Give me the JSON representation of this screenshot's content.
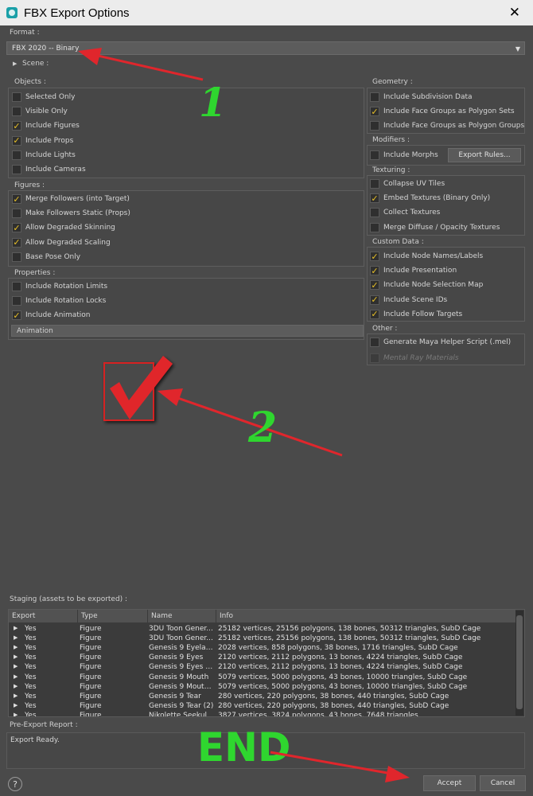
{
  "window": {
    "title": "FBX Export Options",
    "close_glyph": "✕"
  },
  "format": {
    "label": "Format :",
    "value": "FBX 2020 -- Binary"
  },
  "scene": {
    "label": "Scene :"
  },
  "objects": {
    "label": "Objects :",
    "items": [
      {
        "label": "Selected Only",
        "checked": false
      },
      {
        "label": "Visible Only",
        "checked": false
      },
      {
        "label": "Include Figures",
        "checked": true
      },
      {
        "label": "Include Props",
        "checked": true
      },
      {
        "label": "Include Lights",
        "checked": false
      },
      {
        "label": "Include Cameras",
        "checked": false
      }
    ]
  },
  "figures": {
    "label": "Figures :",
    "items": [
      {
        "label": "Merge Followers (into Target)",
        "checked": true
      },
      {
        "label": "Make Followers Static (Props)",
        "checked": false
      },
      {
        "label": "Allow Degraded Skinning",
        "checked": true
      },
      {
        "label": "Allow Degraded Scaling",
        "checked": true
      },
      {
        "label": "Base Pose Only",
        "checked": false
      }
    ]
  },
  "properties": {
    "label": "Properties :",
    "items": [
      {
        "label": "Include Rotation Limits",
        "checked": false
      },
      {
        "label": "Include Rotation Locks",
        "checked": false
      },
      {
        "label": "Include Animation",
        "checked": true
      }
    ]
  },
  "animation": {
    "label": "Animation"
  },
  "geometry": {
    "label": "Geometry :",
    "items": [
      {
        "label": "Include Subdivision Data",
        "checked": false
      },
      {
        "label": "Include Face Groups as Polygon Sets",
        "checked": true
      },
      {
        "label": "Include Face Groups as Polygon Groups",
        "checked": false
      }
    ]
  },
  "modifiers": {
    "label": "Modifiers :",
    "items": [
      {
        "label": "Include Morphs",
        "checked": false
      }
    ],
    "export_rules": "Export Rules..."
  },
  "texturing": {
    "label": "Texturing :",
    "items": [
      {
        "label": "Collapse UV Tiles",
        "checked": false
      },
      {
        "label": "Embed Textures (Binary Only)",
        "checked": true
      },
      {
        "label": "Collect Textures",
        "checked": false
      },
      {
        "label": "Merge Diffuse / Opacity Textures",
        "checked": false
      }
    ]
  },
  "custom_data": {
    "label": "Custom Data :",
    "items": [
      {
        "label": "Include Node Names/Labels",
        "checked": true
      },
      {
        "label": "Include Presentation",
        "checked": true
      },
      {
        "label": "Include Node Selection Map",
        "checked": true
      },
      {
        "label": "Include Scene IDs",
        "checked": true
      },
      {
        "label": "Include Follow Targets",
        "checked": true
      }
    ]
  },
  "other": {
    "label": "Other :",
    "items": [
      {
        "label": "Generate Maya Helper Script (.mel)",
        "checked": false
      },
      {
        "label": "Mental Ray Materials",
        "checked": false,
        "disabled": true
      }
    ]
  },
  "staging": {
    "label": "Staging (assets to be exported) :",
    "columns": [
      "Export",
      "Type",
      "Name",
      "Info"
    ],
    "rows": [
      [
        "Yes",
        "Figure",
        "3DU Toon Gener...",
        "25182 vertices, 25156 polygons, 138 bones, 50312 triangles, SubD Cage"
      ],
      [
        "Yes",
        "Figure",
        "3DU Toon Gener...",
        "25182 vertices, 25156 polygons, 138 bones, 50312 triangles, SubD Cage"
      ],
      [
        "Yes",
        "Figure",
        "Genesis 9 Eyelas...",
        "2028 vertices, 858 polygons, 38 bones, 1716 triangles, SubD Cage"
      ],
      [
        "Yes",
        "Figure",
        "Genesis 9 Eyes",
        "2120 vertices, 2112 polygons, 13 bones, 4224 triangles, SubD Cage"
      ],
      [
        "Yes",
        "Figure",
        "Genesis 9 Eyes (2)",
        "2120 vertices, 2112 polygons, 13 bones, 4224 triangles, SubD Cage"
      ],
      [
        "Yes",
        "Figure",
        "Genesis 9 Mouth",
        "5079 vertices, 5000 polygons, 43 bones, 10000 triangles, SubD Cage"
      ],
      [
        "Yes",
        "Figure",
        "Genesis 9 Mouth ...",
        "5079 vertices, 5000 polygons, 43 bones, 10000 triangles, SubD Cage"
      ],
      [
        "Yes",
        "Figure",
        "Genesis 9 Tear",
        "280 vertices, 220 polygons, 38 bones, 440 triangles, SubD Cage"
      ],
      [
        "Yes",
        "Figure",
        "Genesis 9 Tear (2)",
        "280 vertices, 220 polygons, 38 bones, 440 triangles, SubD Cage"
      ],
      [
        "Yes",
        "Figure",
        "Nikolette Seekul",
        "3827 vertices, 3824 polygons, 43 bones, 7648 triangles"
      ]
    ]
  },
  "report": {
    "label": "Pre-Export Report :",
    "text": "Export Ready."
  },
  "footer": {
    "help": "?",
    "accept": "Accept",
    "cancel": "Cancel"
  },
  "annotations": {
    "one": "1",
    "two": "2",
    "end": "END",
    "arrow_color": "#e0262c",
    "text_color": "#2fd62f"
  },
  "icons": {
    "dropdown": "▼",
    "expand": "▶",
    "check": "✓"
  }
}
